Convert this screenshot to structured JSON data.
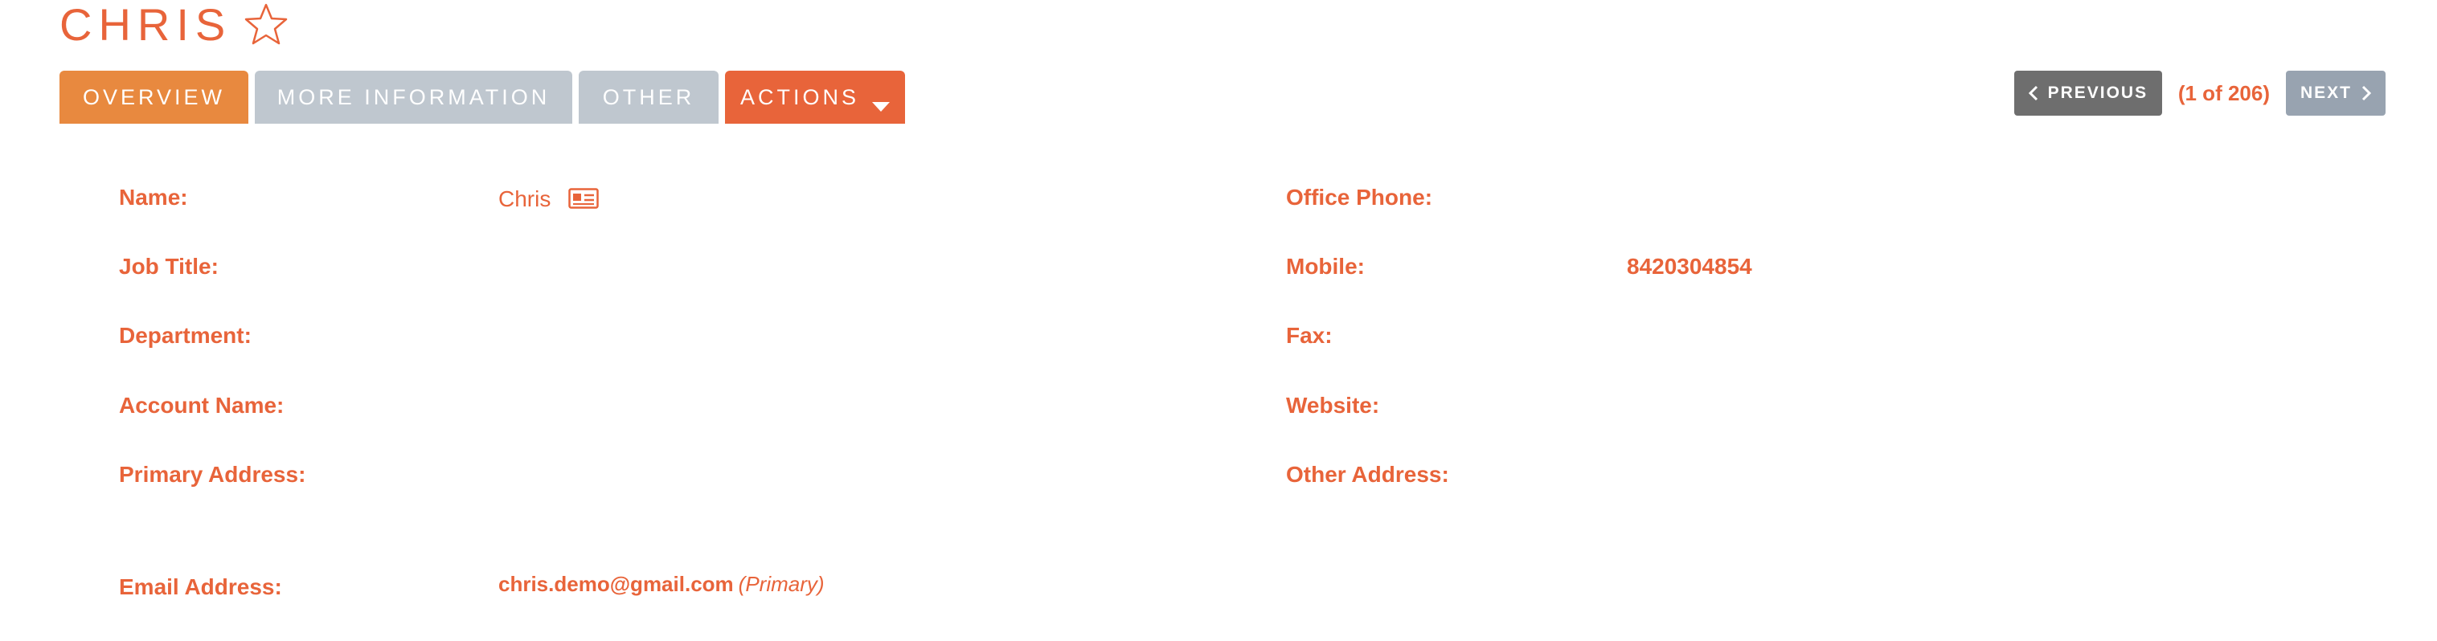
{
  "record": {
    "title": "CHRIS"
  },
  "tabs": [
    {
      "label": "OVERVIEW"
    },
    {
      "label": "MORE INFORMATION"
    },
    {
      "label": "OTHER"
    },
    {
      "label": "ACTIONS"
    }
  ],
  "pager": {
    "previous_label": "PREVIOUS",
    "counter": "(1 of 206)",
    "next_label": "NEXT"
  },
  "fields_left": [
    {
      "label": "Name:",
      "value": "Chris"
    },
    {
      "label": "Job Title:",
      "value": ""
    },
    {
      "label": "Department:",
      "value": ""
    },
    {
      "label": "Account Name:",
      "value": ""
    },
    {
      "label": "Primary Address:",
      "value": ""
    },
    {
      "label": "Email Address:",
      "value": "chris.demo@gmail.com",
      "tag": "(Primary)"
    }
  ],
  "fields_right": [
    {
      "label": "Office Phone:",
      "value": ""
    },
    {
      "label": "Mobile:",
      "value": "8420304854"
    },
    {
      "label": "Fax:",
      "value": ""
    },
    {
      "label": "Website:",
      "value": ""
    },
    {
      "label": "Other Address:",
      "value": ""
    }
  ],
  "colors": {
    "accent": "#e8643a",
    "tab_active": "#e8893f",
    "tab_inactive": "#bfc7cf",
    "prev_button": "#6e6e6e",
    "next_button": "#98a3b0"
  },
  "icons": {
    "favorite": "star-icon",
    "actions_dropdown": "caret-down-icon",
    "previous": "chevron-left-icon",
    "next": "chevron-right-icon",
    "name_card": "vcard-icon"
  }
}
